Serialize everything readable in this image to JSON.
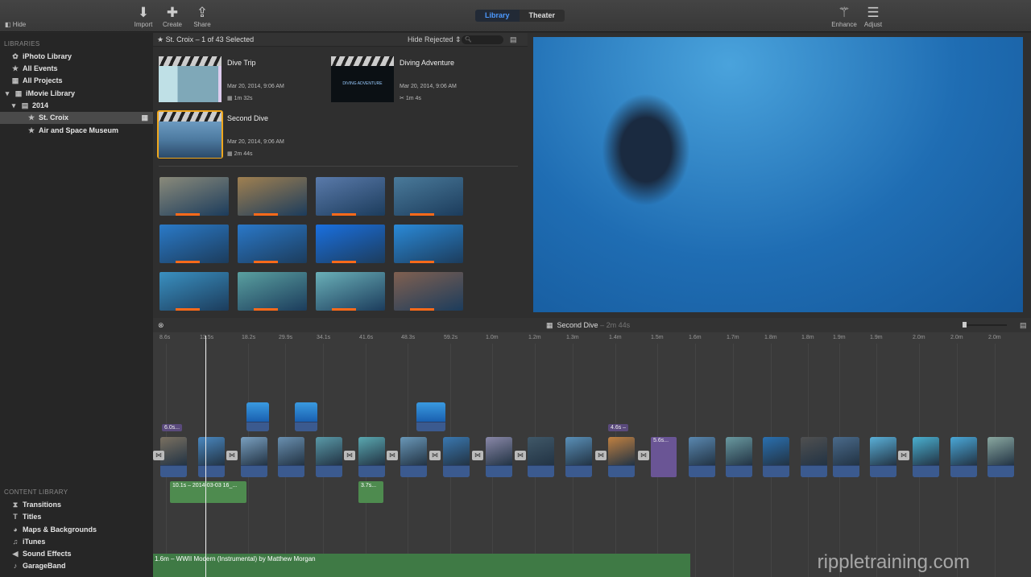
{
  "toolbar": {
    "hide": "Hide",
    "import": "Import",
    "create": "Create",
    "share": "Share",
    "library": "Library",
    "theater": "Theater",
    "enhance": "Enhance",
    "adjust": "Adjust"
  },
  "sidebar": {
    "libraries_header": "LIBRARIES",
    "items": [
      "iPhoto Library",
      "All Events",
      "All Projects",
      "iMovie Library",
      "2014",
      "St. Croix",
      "Air and Space Museum"
    ],
    "content_header": "CONTENT LIBRARY",
    "content_items": [
      "Transitions",
      "Titles",
      "Maps & Backgrounds",
      "iTunes",
      "Sound Effects",
      "GarageBand"
    ]
  },
  "browser": {
    "title": "St. Croix – 1 of 43 Selected",
    "filter": "Hide Rejected",
    "projects": [
      {
        "title": "Dive Trip",
        "date": "Mar 20, 2014, 9:06 AM",
        "duration": "1m 32s"
      },
      {
        "title": "Diving Adventure",
        "date": "Mar 20, 2014, 9:06 AM",
        "duration": "1m 4s",
        "thumb_text": "DIVING ADVENTURE"
      },
      {
        "title": "Second Dive",
        "date": "Mar 20, 2014, 9:06 AM",
        "duration": "2m 44s"
      }
    ]
  },
  "timeline": {
    "title": "Second Dive",
    "duration": "– 2m 44s",
    "ruler": [
      "8.6s",
      "13.5s",
      "18.2s",
      "29.9s",
      "34.1s",
      "41.6s",
      "48.3s",
      "59.2s",
      "1.0m",
      "1.2m",
      "1.3m",
      "1.4m",
      "1.5m",
      "1.6m",
      "1.7m",
      "1.8m",
      "1.8m",
      "1.9m",
      "1.9m",
      "2.0m",
      "2.0m",
      "2.0m"
    ],
    "labels": {
      "a": "6.0s...",
      "b": "4.6s –",
      "c": "5.6s..."
    },
    "audio": {
      "a": "10.1s – 2014-03-03 16_...",
      "b": "3.7s..."
    },
    "music": "1.6m – WWII Modern (Instrumental) by Matthew Morgan"
  },
  "watermark": "rippletraining.com"
}
